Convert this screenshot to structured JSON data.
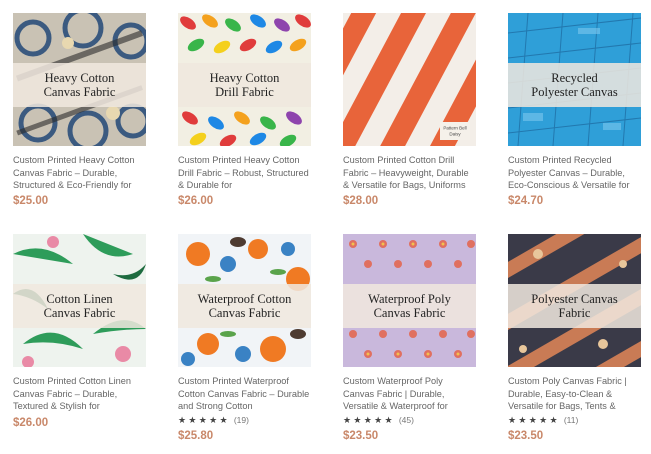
{
  "products": [
    {
      "title_line1": "Heavy Cotton",
      "title_line2": "Canvas Fabric",
      "description": "Custom Printed Heavy Cotton Canvas Fabric – Durable, Structured & Eco-Friendly for",
      "price": "$25.00",
      "stars": "",
      "review_count": ""
    },
    {
      "title_line1": "Heavy Cotton",
      "title_line2": "Drill Fabric",
      "description": "Custom Printed Heavy Cotton Drill Fabric – Robust, Structured & Durable for",
      "price": "$26.00",
      "stars": "",
      "review_count": ""
    },
    {
      "title_line1": "",
      "title_line2": "",
      "description": "Custom Printed Cotton Drill Fabric – Heavyweight, Durable & Versatile for Bags, Uniforms",
      "price": "$28.00",
      "stars": "",
      "review_count": "",
      "image_caption": "Pattern Bell Daisy"
    },
    {
      "title_line1": "Recycled",
      "title_line2": "Polyester Canvas",
      "description": "Custom Printed Recycled Polyester Canvas – Durable, Eco-Conscious & Versatile for",
      "price": "$24.70",
      "stars": "",
      "review_count": ""
    },
    {
      "title_line1": "Cotton Linen",
      "title_line2": "Canvas Fabric",
      "description": "Custom Printed Cotton Linen Canvas Fabric – Durable, Textured & Stylish for",
      "price": "$26.00",
      "stars": "",
      "review_count": ""
    },
    {
      "title_line1": "Waterproof Cotton",
      "title_line2": "Canvas Fabric",
      "description": "Custom Printed Waterproof Cotton Canvas Fabric – Durable and Strong Cotton",
      "price": "$25.80",
      "stars": "★★★★★",
      "review_count": "(19)"
    },
    {
      "title_line1": "Waterproof Poly",
      "title_line2": "Canvas Fabric",
      "description": "Custom Waterproof Poly Canvas Fabric | Durable, Versatile & Waterproof for",
      "price": "$23.50",
      "stars": "★★★★★",
      "review_count": "(45)"
    },
    {
      "title_line1": "Polyester Canvas",
      "title_line2": "Fabric",
      "description": "Custom Poly Canvas Fabric | Durable, Easy-to-Clean & Versatile for Bags, Tents &",
      "price": "$23.50",
      "stars": "★★★★★",
      "review_count": "(11)"
    }
  ],
  "colors": {
    "price": "#c9886a",
    "overlay_bg": "#f0e8de",
    "text": "#666666"
  }
}
